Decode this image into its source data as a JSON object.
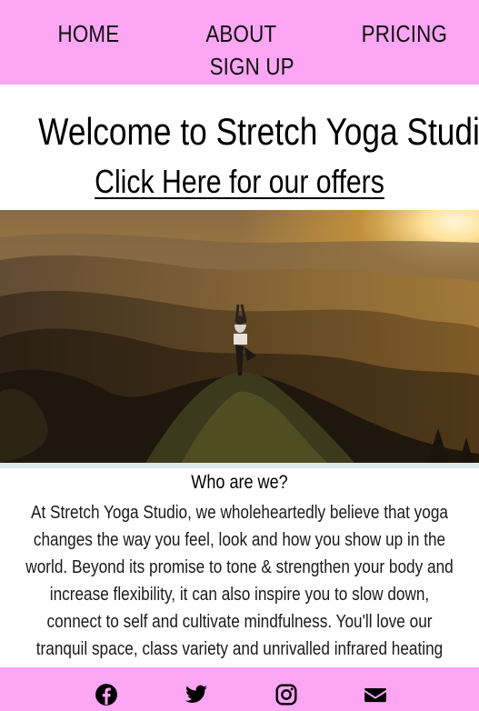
{
  "nav": {
    "home": "HOME",
    "about": "ABOUT",
    "pricing": "PRICING",
    "signup": "SIGN UP"
  },
  "hero": {
    "title": "Welcome to Stretch Yoga Studio",
    "offers_link": "Click Here for our offers"
  },
  "about": {
    "heading": "Who are we?",
    "body": "At Stretch Yoga Studio, we wholeheartedly believe that yoga changes the way you feel, look and how you show up in the world. Beyond its promise to tone & strengthen your body and increase flexibility, it can also inspire you to slow down, connect to self and cultivate mindfulness. You'll love our tranquil space, class variety and unrivalled infrared heating experience.Our friendly teachers are"
  },
  "footer": {
    "icons": [
      "facebook-icon",
      "twitter-icon",
      "instagram-icon",
      "envelope-icon"
    ]
  },
  "colors": {
    "nav_bg": "#fca6f4",
    "footer_bg": "#fca6f4",
    "text": "#111111"
  }
}
